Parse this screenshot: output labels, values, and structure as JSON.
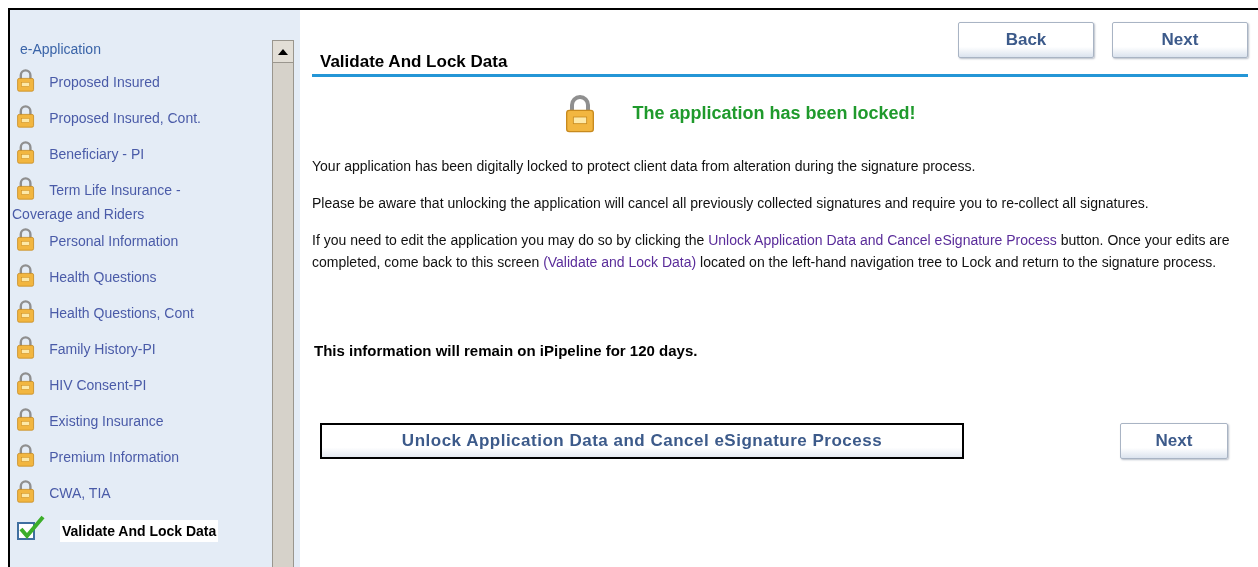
{
  "sidebar": {
    "title": "e-Application",
    "items": [
      {
        "label": "Proposed Insured",
        "kind": "locked",
        "selected": false
      },
      {
        "label": "Proposed Insured, Cont.",
        "kind": "locked",
        "selected": false
      },
      {
        "label": "Beneficiary - PI",
        "kind": "locked",
        "selected": false
      },
      {
        "label": "Term Life Insurance -",
        "continuation": "Coverage and Riders",
        "kind": "locked",
        "selected": false
      },
      {
        "label": "Personal Information",
        "kind": "locked",
        "selected": false
      },
      {
        "label": "Health Questions",
        "kind": "locked",
        "selected": false
      },
      {
        "label": "Health Questions, Cont",
        "kind": "locked",
        "selected": false
      },
      {
        "label": "Family History-PI",
        "kind": "locked",
        "selected": false
      },
      {
        "label": "HIV Consent-PI",
        "kind": "locked",
        "selected": false
      },
      {
        "label": "Existing Insurance",
        "kind": "locked",
        "selected": false
      },
      {
        "label": "Premium Information",
        "kind": "locked",
        "selected": false
      },
      {
        "label": "CWA, TIA",
        "kind": "locked",
        "selected": false
      },
      {
        "label": "Validate And Lock Data",
        "kind": "done",
        "selected": true
      }
    ]
  },
  "nav_buttons": [
    "Back",
    "Next"
  ],
  "page_title": "Validate And Lock Data",
  "status_message": "The application has been locked!",
  "paragraphs": [
    [
      {
        "kind": "text",
        "text": "Your application has been digitally locked to protect client data from alteration during the signature process."
      }
    ],
    [
      {
        "kind": "text",
        "text": "Please be aware that unlocking the application will cancel all previously collected signatures and require you to re-collect all signatures."
      }
    ],
    [
      {
        "kind": "text",
        "text": "If you need to edit the application you may do so by clicking the"
      },
      {
        "kind": "link",
        "text": "Unlock Application Data and Cancel eSignature Process"
      },
      {
        "kind": "text",
        "text": "button. Once your edits are completed, come back to this screen"
      },
      {
        "kind": "link",
        "text": "(Validate and Lock Data)"
      },
      {
        "kind": "text",
        "text": "located on the left-hand navigation tree to Lock and return to the signature process."
      }
    ]
  ],
  "retention_note": "This information will remain on iPipeline for 120 days.",
  "unlock_button": "Unlock Application Data and Cancel eSignature Process",
  "next_button": "Next"
}
